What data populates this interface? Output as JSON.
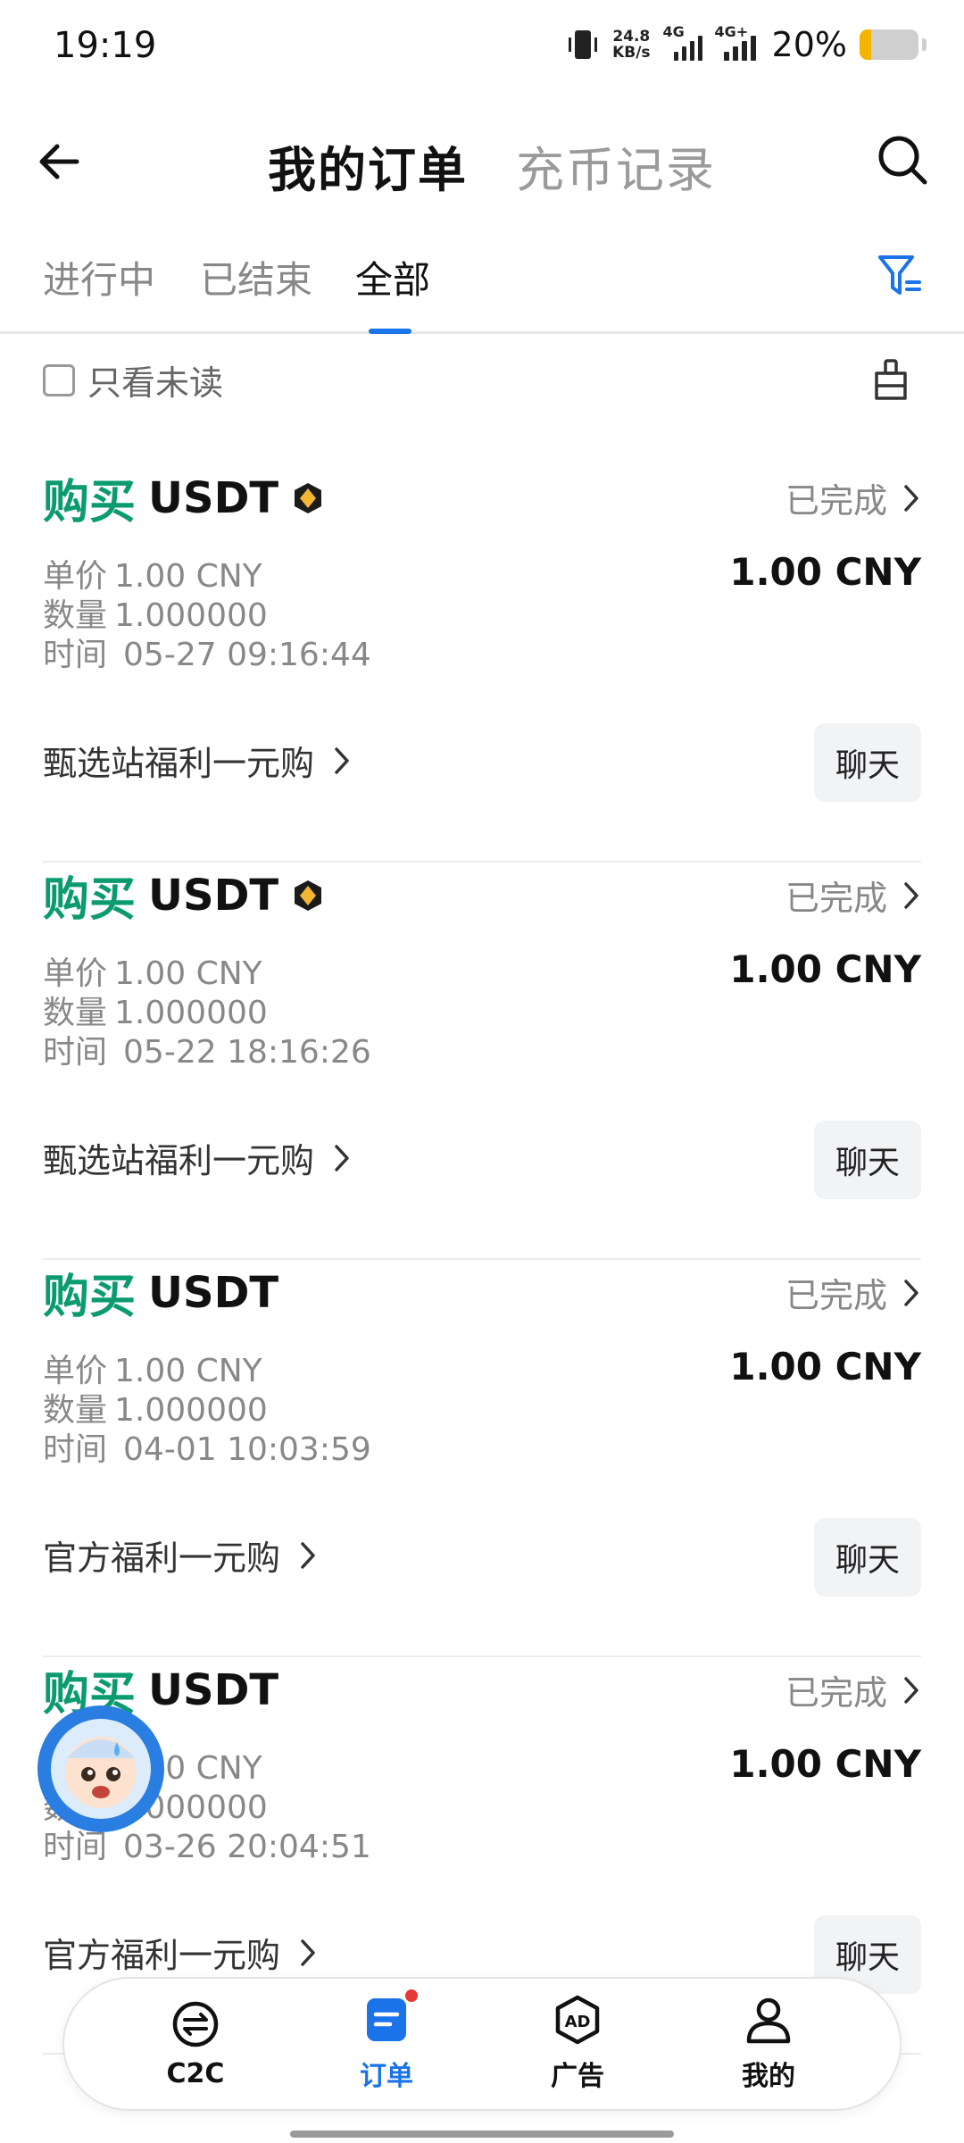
{
  "status_bar": {
    "time": "19:19",
    "net_speed_value": "24.8",
    "net_speed_unit": "KB/s",
    "signal1_label": "4G",
    "signal2_label": "4G+",
    "battery_percent": "20%",
    "battery_level": 0.2,
    "battery_color": "#f5b400"
  },
  "header": {
    "tabs": [
      {
        "label": "我的订单",
        "active": true
      },
      {
        "label": "充币记录",
        "active": false
      }
    ]
  },
  "subtabs": [
    {
      "label": "进行中"
    },
    {
      "label": "已结束"
    },
    {
      "label": "全部",
      "active": true
    }
  ],
  "unread_filter": {
    "label": "只看未读",
    "checked": false
  },
  "orders": [
    {
      "side": "购买",
      "asset": "USDT",
      "badge": true,
      "status": "已完成",
      "price_label": "单价",
      "price": "1.00 CNY",
      "qty_label": "数量",
      "qty": "1.000000",
      "time_label": "时间",
      "time": "05-27 09:16:44",
      "amount": "1.00 CNY",
      "promo": "甄选站福利一元购",
      "chat": "聊天"
    },
    {
      "side": "购买",
      "asset": "USDT",
      "badge": true,
      "status": "已完成",
      "price_label": "单价",
      "price": "1.00 CNY",
      "qty_label": "数量",
      "qty": "1.000000",
      "time_label": "时间",
      "time": "05-22 18:16:26",
      "amount": "1.00 CNY",
      "promo": "甄选站福利一元购",
      "chat": "聊天"
    },
    {
      "side": "购买",
      "asset": "USDT",
      "badge": false,
      "status": "已完成",
      "price_label": "单价",
      "price": "1.00 CNY",
      "qty_label": "数量",
      "qty": "1.000000",
      "time_label": "时间",
      "time": "04-01 10:03:59",
      "amount": "1.00 CNY",
      "promo": "官方福利一元购",
      "chat": "聊天"
    },
    {
      "side": "购买",
      "asset": "USDT",
      "badge": false,
      "status": "已完成",
      "price_label": "单价",
      "price": "1.00 CNY",
      "qty_label": "数量",
      "qty": "1.000000",
      "time_label": "时间",
      "time": "03-26 20:04:51",
      "amount": "1.00 CNY",
      "promo": "官方福利一元购",
      "chat": "聊天"
    }
  ],
  "bottom_nav": [
    {
      "label": "C2C",
      "icon": "swap-icon"
    },
    {
      "label": "订单",
      "icon": "order-icon",
      "active": true,
      "dot": true
    },
    {
      "label": "广告",
      "icon": "ad-icon"
    },
    {
      "label": "我的",
      "icon": "user-icon"
    }
  ],
  "colors": {
    "accent": "#1a73e8",
    "buy": "#0b9b6f",
    "badge": "#e53935"
  }
}
